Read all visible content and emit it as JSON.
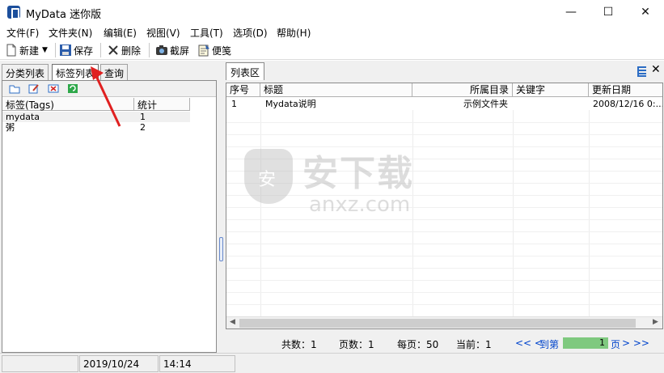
{
  "window": {
    "title": "MyData  迷你版",
    "controls": {
      "minimize": "—",
      "maximize": "☐",
      "close": "✕"
    }
  },
  "menu": [
    "文件(F)",
    "文件夹(N)",
    "编辑(E)",
    "视图(V)",
    "工具(T)",
    "选项(D)",
    "帮助(H)"
  ],
  "toolbar": {
    "new_label": "新建",
    "save_label": "保存",
    "delete_label": "删除",
    "screenshot_label": "截屏",
    "note_label": "便笺"
  },
  "left": {
    "tabs": [
      "分类列表",
      "标签列表",
      "查询"
    ],
    "active_tab": "标签列表",
    "columns": [
      "标签(Tags)",
      "统计"
    ],
    "rows": [
      {
        "tag": "mydata",
        "count": "1"
      },
      {
        "tag": "粥",
        "count": "2"
      }
    ]
  },
  "right": {
    "tab": "列表区",
    "columns": [
      "序号",
      "标题",
      "所属目录",
      "关键字",
      "更新日期"
    ],
    "rows": [
      {
        "index": "1",
        "title": "Mydata说明",
        "folder": "示例文件夹",
        "keywords": "",
        "updated": "2008/12/16 0:..."
      }
    ]
  },
  "watermark": {
    "cn": "安下载",
    "en": "anxz.com"
  },
  "pager": {
    "total": "共数：1",
    "pages": "页数：1",
    "per_page": "每页：50",
    "current": "当前：1",
    "first_prev": "<< <",
    "goto": "到第",
    "page_value": "1",
    "page_suffix": "页",
    "next_last": "> >>"
  },
  "status": {
    "date": "2019/10/24",
    "time": "14:14"
  },
  "colors": {
    "accent_blue": "#0044cc",
    "page_input_green": "#7fc97f",
    "annotation_red": "#e02020"
  }
}
